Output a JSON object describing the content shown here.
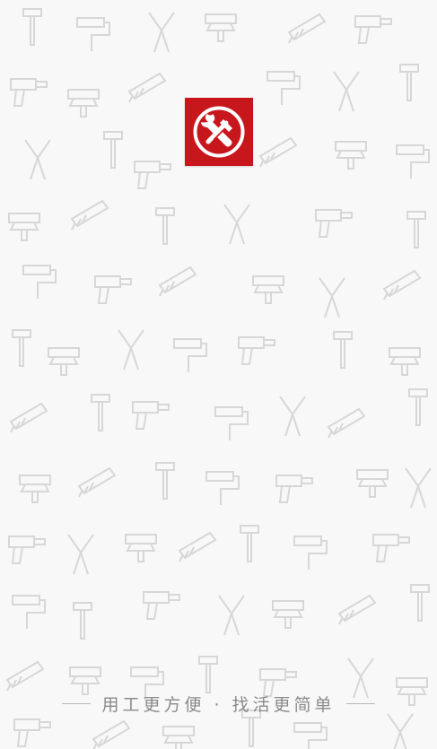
{
  "splash": {
    "slogan": "用工更方便 · 找活更简单",
    "accent_color": "#c8161d",
    "background_color": "#f8f8f8",
    "logo_icon": "crossed-wrench-hammer-icon",
    "background_pattern": "construction-tools-pattern"
  }
}
